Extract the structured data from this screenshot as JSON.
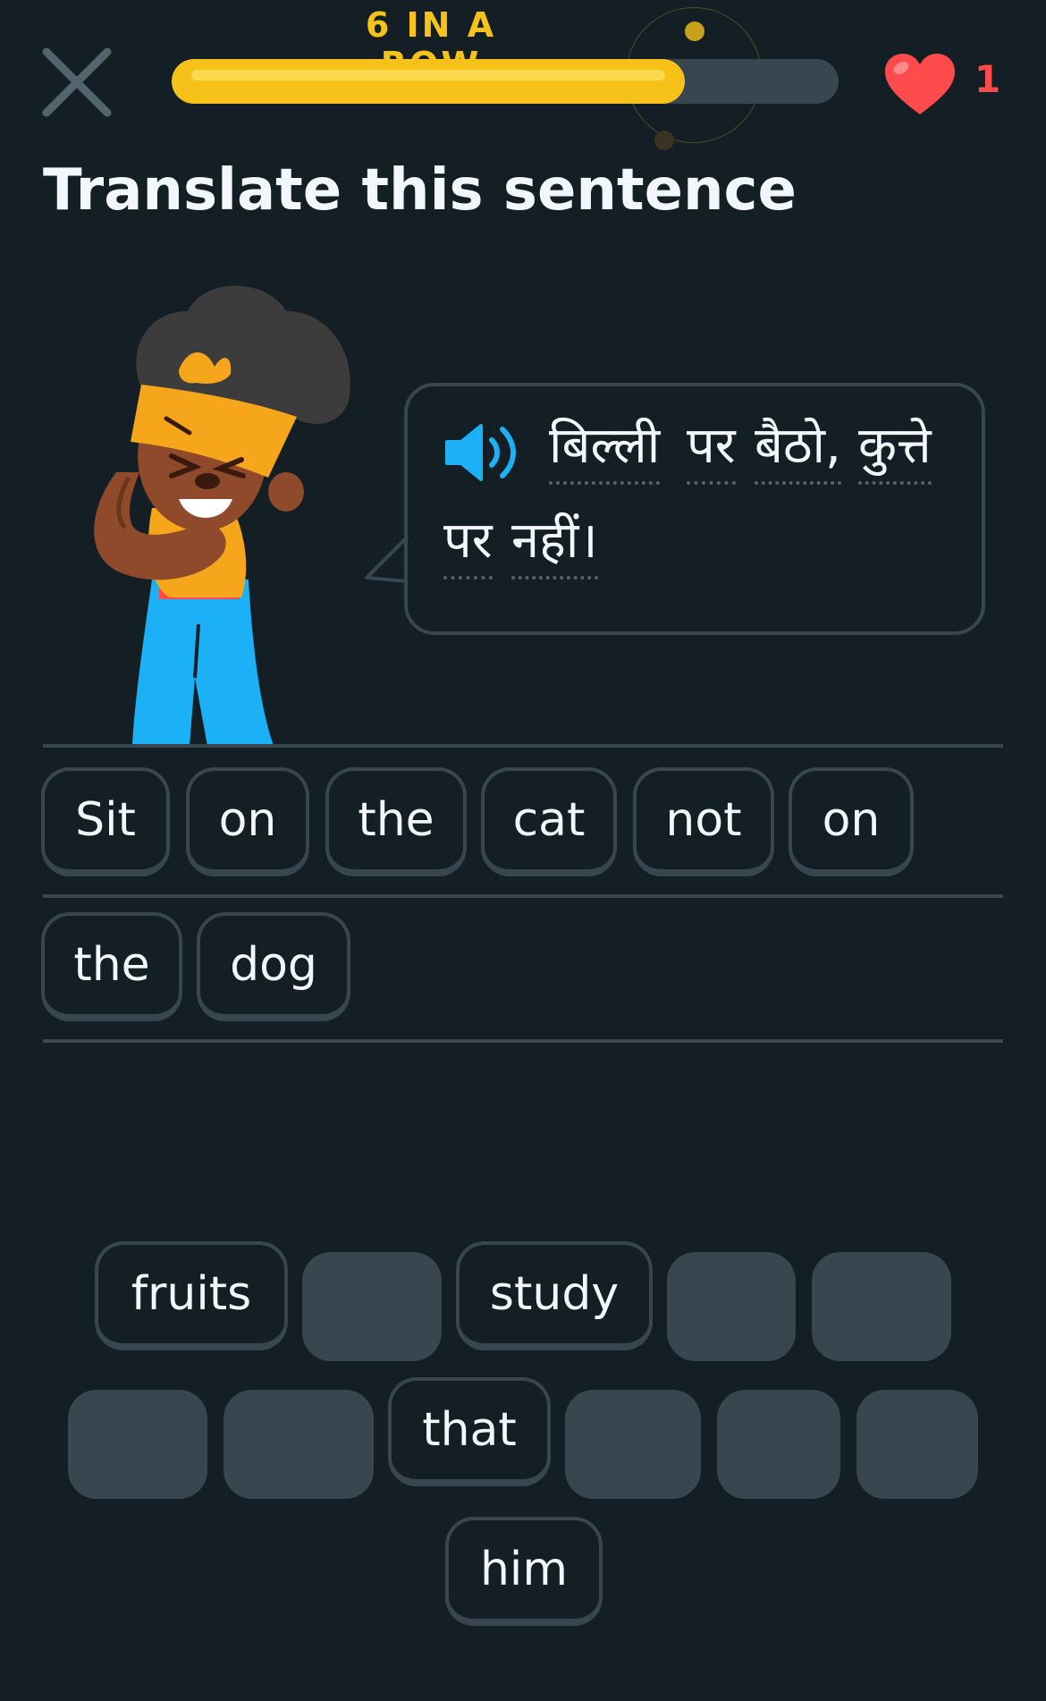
{
  "header": {
    "streak_label": "6 IN A ROW",
    "progress": 0.77,
    "hearts_count": "1"
  },
  "prompt": {
    "title": "Translate this sentence"
  },
  "bubble": {
    "words_line1": [
      "बिल्ली",
      "पर",
      "बैठो,",
      "कुत्ते"
    ],
    "words_line2": [
      "पर",
      "नहीं।"
    ]
  },
  "answer": {
    "chips": [
      "Sit",
      "on",
      "the",
      "cat",
      "not",
      "on",
      "the",
      "dog"
    ]
  },
  "bank": {
    "chips": [
      "fruits",
      "study",
      "that",
      "him"
    ]
  },
  "colors": {
    "background": "#131f24",
    "accent_yellow": "#f6c21a",
    "border": "#37464f",
    "heart_red": "#ff4b4b",
    "speaker_blue": "#1cb0f6",
    "text": "#f1f7fb"
  },
  "icons": {
    "close": "close-icon",
    "heart": "heart-icon",
    "speaker": "speaker-icon"
  }
}
